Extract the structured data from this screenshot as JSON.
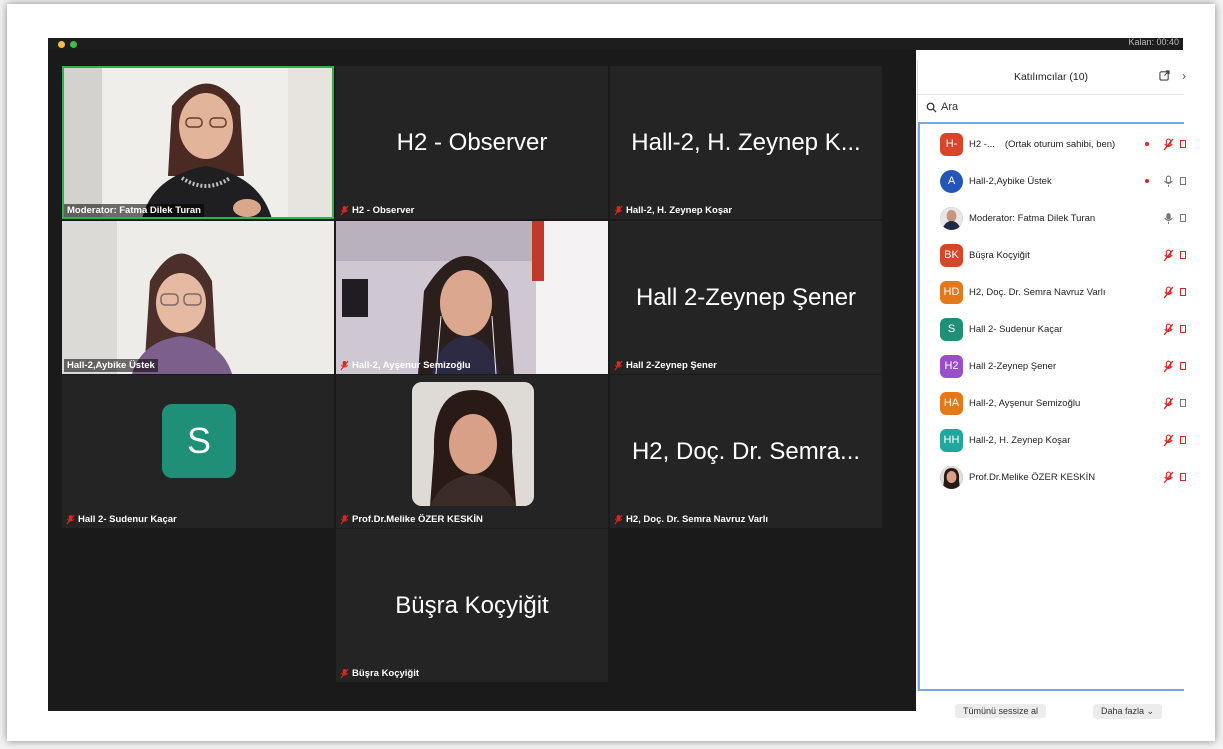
{
  "window": {
    "timer": "Kalan: 00:40"
  },
  "tiles": {
    "moderator": {
      "caption": "Moderator: Fatma Dilek Turan"
    },
    "observer": {
      "big": "H2 - Observer",
      "caption": "H2 - Observer"
    },
    "kosar": {
      "big": "Hall-2, H. Zeynep K...",
      "caption": "Hall-2, H. Zeynep Koşar"
    },
    "aybike": {
      "caption": "Hall-2,Aybike Üstek"
    },
    "aysenur": {
      "caption": "Hall-2, Ayşenur Semizoğlu"
    },
    "sener": {
      "big": "Hall 2-Zeynep Şener",
      "caption": "Hall 2-Zeynep Şener"
    },
    "sudenur": {
      "avatar": "S",
      "caption": "Hall 2- Sudenur Kaçar"
    },
    "melike": {
      "caption": "Prof.Dr.Melike ÖZER KESKİN"
    },
    "semra": {
      "big": "H2, Doç. Dr. Semra...",
      "caption": "H2, Doç. Dr. Semra Navruz Varlı"
    },
    "busra": {
      "big": "Büşra Koçyiğit",
      "caption": "Büşra Koçyiğit"
    }
  },
  "panel": {
    "title": "Katılımcılar (10)",
    "search_placeholder": "Ara",
    "participants": [
      {
        "initials": "H-",
        "name": "H2 -...",
        "role": "(Ortak oturum sahibi, ben)",
        "color": "#d9452b"
      },
      {
        "initials": "A",
        "name": "Hall-2,Aybike Üstek",
        "color": "#2455b8"
      },
      {
        "initials": "",
        "name": "Moderator: Fatma Dilek Turan",
        "color": "#5a6a88"
      },
      {
        "initials": "BK",
        "name": "Büşra Koçyiğit",
        "color": "#d9452b"
      },
      {
        "initials": "HD",
        "name": "H2, Doç. Dr. Semra Navruz Varlı",
        "color": "#e57817"
      },
      {
        "initials": "S",
        "name": "Hall 2- Sudenur Kaçar",
        "color": "#1f8f78"
      },
      {
        "initials": "H2",
        "name": "Hall 2-Zeynep Şener",
        "color": "#9b4ec9"
      },
      {
        "initials": "HA",
        "name": "Hall-2, Ayşenur Semizoğlu",
        "color": "#e57817"
      },
      {
        "initials": "HH",
        "name": "Hall-2, H. Zeynep Koşar",
        "color": "#1fa7a0"
      },
      {
        "initials": "",
        "name": "Prof.Dr.Melike ÖZER KESKİN",
        "color": "#6b3a2a"
      }
    ]
  },
  "footer": {
    "mute_all": "Tümünü sessize al",
    "more": "Daha fazla"
  },
  "colors": {
    "active_speaker": "#2fb14b",
    "muted_red": "#e02424",
    "selection_blue": "#79a6ea"
  }
}
